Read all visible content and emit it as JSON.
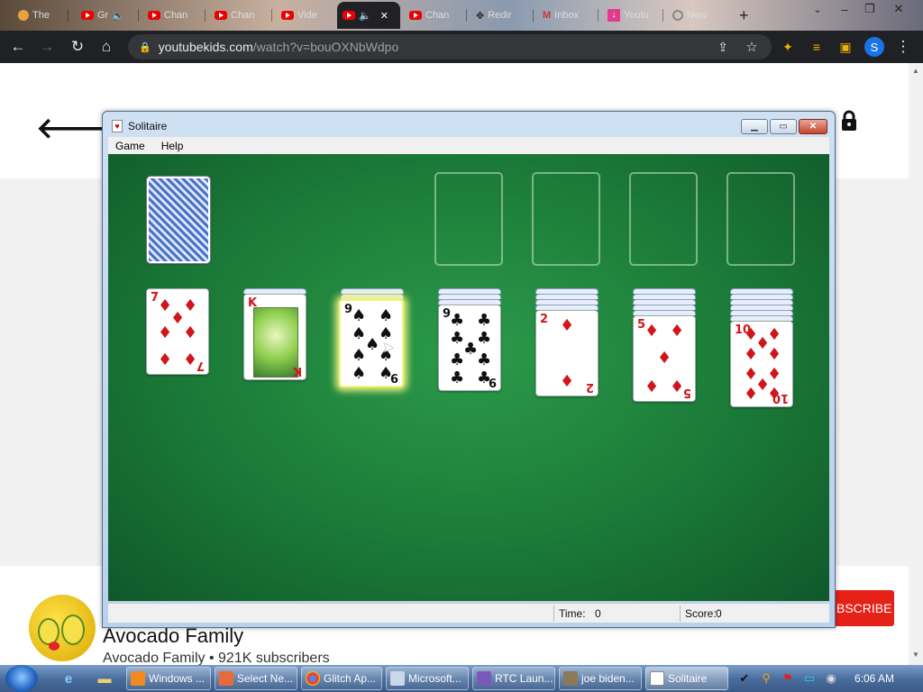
{
  "browser": {
    "tabs": [
      {
        "label": "The"
      },
      {
        "label": "Gr"
      },
      {
        "label": "Chan"
      },
      {
        "label": "Chan"
      },
      {
        "label": "Vide"
      },
      {
        "label": ""
      },
      {
        "label": "Chan"
      },
      {
        "label": "Redir"
      },
      {
        "label": "Inbox"
      },
      {
        "label": "Youtu"
      },
      {
        "label": "New"
      }
    ],
    "new_tab_symbol": "+",
    "url_host": "youtubekids.com",
    "url_path": "/watch?v=bouOXNbWdpo",
    "profile_initial": "S"
  },
  "page": {
    "channel_name": "Avocado Family",
    "channel_meta": "Avocado Family • 921K subscribers",
    "subscribe_label": "BSCRIBE",
    "accent_color": "#e62117"
  },
  "solitaire": {
    "title": "Solitaire",
    "menu": [
      "Game",
      "Help"
    ],
    "status": {
      "time_label": "Time:",
      "time_value": "0",
      "score_label": "Score:",
      "score_value": "0"
    },
    "tableau": [
      {
        "rank": "7",
        "suit": "♦",
        "color": "red",
        "hidden_below": 0
      },
      {
        "rank": "K",
        "suit": "♥",
        "color": "red",
        "hidden_below": 1
      },
      {
        "rank": "9",
        "suit": "♠",
        "color": "black",
        "hidden_below": 2,
        "selected": true
      },
      {
        "rank": "9",
        "suit": "♣",
        "color": "black",
        "hidden_below": 3
      },
      {
        "rank": "2",
        "suit": "♦",
        "color": "red",
        "hidden_below": 4
      },
      {
        "rank": "5",
        "suit": "♦",
        "color": "red",
        "hidden_below": 5
      },
      {
        "rank": "10",
        "suit": "♦",
        "color": "red",
        "hidden_below": 6
      }
    ],
    "foundations": 4
  },
  "taskbar": {
    "items": [
      {
        "label": "Windows ..."
      },
      {
        "label": "Select Ne..."
      },
      {
        "label": "Glitch Ap..."
      },
      {
        "label": "Microsoft..."
      },
      {
        "label": "RTC Laun..."
      },
      {
        "label": "joe biden..."
      },
      {
        "label": "Solitaire"
      }
    ],
    "clock": "6:06 AM"
  }
}
